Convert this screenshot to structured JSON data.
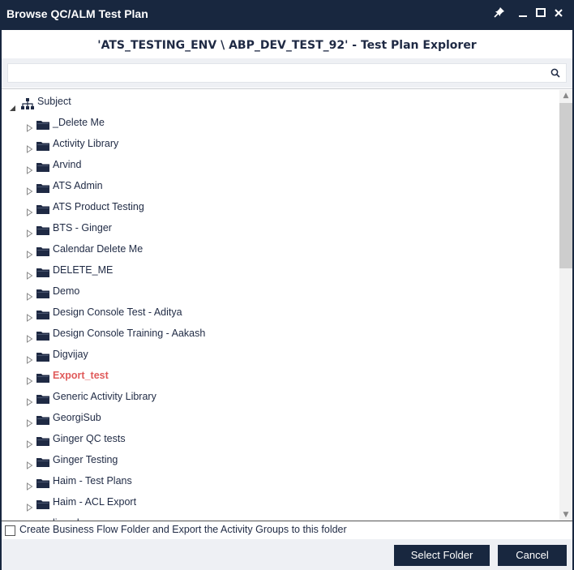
{
  "window": {
    "title": "Browse QC/ALM Test Plan",
    "controls": [
      "pin-icon",
      "minimize-icon",
      "maximize-icon",
      "close-icon"
    ]
  },
  "explorer": {
    "title": "'ATS_TESTING_ENV \\ ABP_DEV_TEST_92' - Test Plan Explorer"
  },
  "search": {
    "value": "",
    "placeholder": "",
    "icon": "search-icon"
  },
  "tree": {
    "root": {
      "label": "Subject",
      "icon": "hierarchy-icon",
      "expanded": true
    },
    "items": [
      {
        "label": "_Delete Me"
      },
      {
        "label": "Activity Library"
      },
      {
        "label": "Arvind"
      },
      {
        "label": "ATS Admin"
      },
      {
        "label": "ATS Product Testing"
      },
      {
        "label": "BTS - Ginger"
      },
      {
        "label": "Calendar Delete Me"
      },
      {
        "label": "DELETE_ME"
      },
      {
        "label": "Demo"
      },
      {
        "label": "Design Console Test - Aditya"
      },
      {
        "label": "Design Console Training - Aakash"
      },
      {
        "label": "Digvijay"
      },
      {
        "label": "Export_test",
        "highlighted": true
      },
      {
        "label": "Generic Activity Library"
      },
      {
        "label": "GeorgiSub"
      },
      {
        "label": "Ginger QC tests"
      },
      {
        "label": "Ginger Testing"
      },
      {
        "label": "Haim  - Test Plans"
      },
      {
        "label": "Haim - ACL Export"
      },
      {
        "label": "lisrael"
      }
    ]
  },
  "options": {
    "create_folder_label": "Create Business Flow Folder and Export the Activity Groups to this folder",
    "create_folder_checked": false
  },
  "buttons": {
    "select": "Select Folder",
    "cancel": "Cancel"
  },
  "colors": {
    "header": "#18273f",
    "highlight": "#e05b5b",
    "text": "#1f2a44"
  }
}
